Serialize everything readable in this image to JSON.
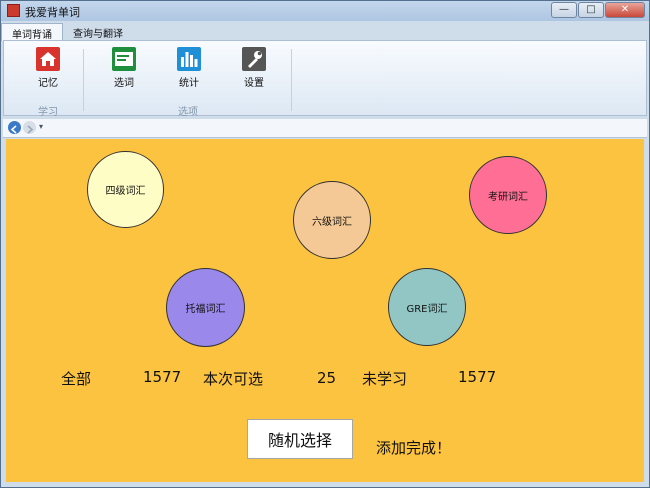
{
  "window": {
    "title": "我爱背单词"
  },
  "tabs": [
    {
      "label": "单词背诵"
    },
    {
      "label": "查询与翻译"
    }
  ],
  "ribbon": {
    "buttons": [
      {
        "label": "记忆"
      },
      {
        "label": "选词"
      },
      {
        "label": "统计"
      },
      {
        "label": "设置"
      }
    ],
    "groups": [
      {
        "label": "学习"
      },
      {
        "label": "选项"
      }
    ]
  },
  "categories": [
    {
      "label": "四级词汇",
      "color": "#fffdc6"
    },
    {
      "label": "六级词汇",
      "color": "#f4c995"
    },
    {
      "label": "考研词汇",
      "color": "#ff6f95"
    },
    {
      "label": "托福词汇",
      "color": "#9a88ea"
    },
    {
      "label": "GRE词汇",
      "color": "#92c6c5"
    }
  ],
  "stats": {
    "total_label": "全部",
    "total_value": "1577",
    "available_label": "本次可选",
    "available_value": "25",
    "unlearned_label": "未学习",
    "unlearned_value": "1577"
  },
  "random_button": "随机选择",
  "status_message": "添加完成！",
  "colors": {
    "content_bg": "#fcc341",
    "ribbon_bg": "#f8fbfe"
  }
}
